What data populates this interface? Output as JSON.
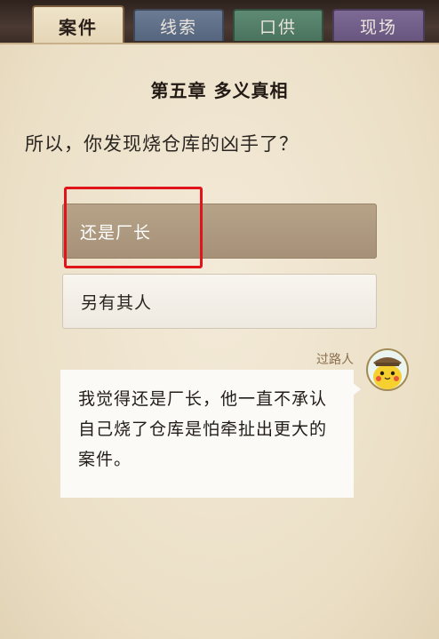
{
  "tabs": [
    {
      "label": "案件"
    },
    {
      "label": "线索"
    },
    {
      "label": "口供"
    },
    {
      "label": "现场"
    }
  ],
  "chapter_title": "第五章 多义真相",
  "question": "所以，你发现烧仓库的凶手了？",
  "options": [
    {
      "label": "还是厂长",
      "selected": true
    },
    {
      "label": "另有其人",
      "selected": false
    }
  ],
  "dialogue": {
    "speaker": "过路人",
    "avatar_icon": "pikachu-detective-avatar-icon",
    "lines": [
      "我觉得还是厂长，他一直不承认",
      "自己烧了仓库是怕牵扯出更大的",
      "案件。"
    ]
  },
  "colors": {
    "highlight": "#e0141a",
    "selected_option": "#a69178"
  }
}
